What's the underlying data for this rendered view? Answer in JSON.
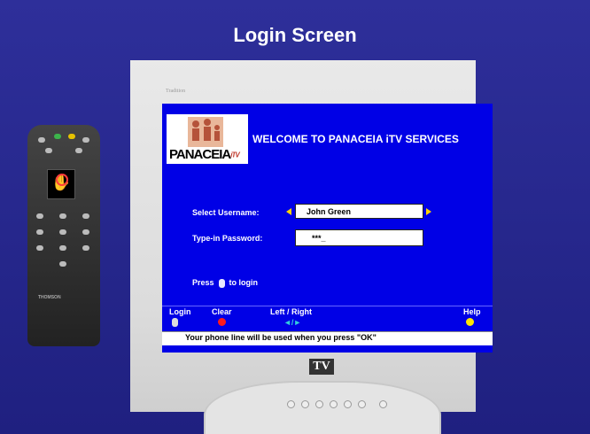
{
  "slide": {
    "title": "Login Screen"
  },
  "tv": {
    "brand_top": "Tradition",
    "badge": "TV",
    "screen": {
      "logo": {
        "text": "PANACEIA",
        "suffix": "iTV"
      },
      "welcome": "WELCOME TO PANACEIA iTV SERVICES",
      "username": {
        "label": "Select Username:",
        "value": "John Green"
      },
      "password": {
        "label": "Type-in Password:",
        "value": "***_"
      },
      "press": {
        "before": "Press",
        "after": "to login"
      },
      "bottom_bar": {
        "login": "Login",
        "clear": "Clear",
        "left_right": "Left / Right",
        "left_right_arrows": "◄/►",
        "help": "Help"
      },
      "status": "Your phone line will be used when you press \"OK\""
    }
  },
  "remote": {
    "brand": "THOMSON"
  },
  "colors": {
    "slide_bg": "#2e2f9a",
    "screen_bg": "#0000e6",
    "accent_yellow": "#ffd400",
    "clear_red": "#ff1a1a"
  }
}
